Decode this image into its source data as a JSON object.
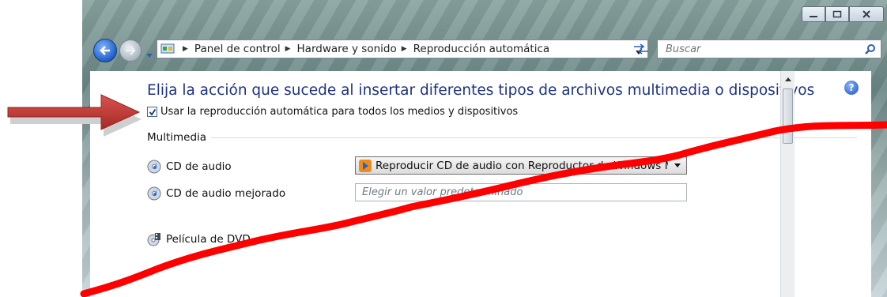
{
  "window": {
    "buttons": [
      "minimize",
      "maximize",
      "close"
    ]
  },
  "nav": {
    "breadcrumbs": [
      "Panel de control",
      "Hardware y sonido",
      "Reproducción automática"
    ],
    "search_placeholder": "Buscar"
  },
  "main": {
    "title": "Elija la acción que sucede al insertar diferentes tipos de archivos multimedia o dispositivos",
    "help_icon_glyph": "?",
    "autoplay_checkbox": {
      "label": "Usar la reproducción automática para todos los medios y dispositivos",
      "checked": true
    },
    "section_multimedia": "Multimedia",
    "items": [
      {
        "label": "CD de audio",
        "icon": "audio-cd-icon",
        "value": "Reproducir CD de audio con Reproductor de Windows Me"
      },
      {
        "label": "CD de audio mejorado",
        "icon": "enhanced-audio-cd-icon",
        "value": "Elegir un valor predeterminado"
      },
      {
        "label": "Película de DVD",
        "icon": "dvd-movie-icon",
        "value": ""
      }
    ]
  },
  "overlay": {
    "arrow_color": "#c0392b",
    "scribble_color": "#ff0000"
  }
}
